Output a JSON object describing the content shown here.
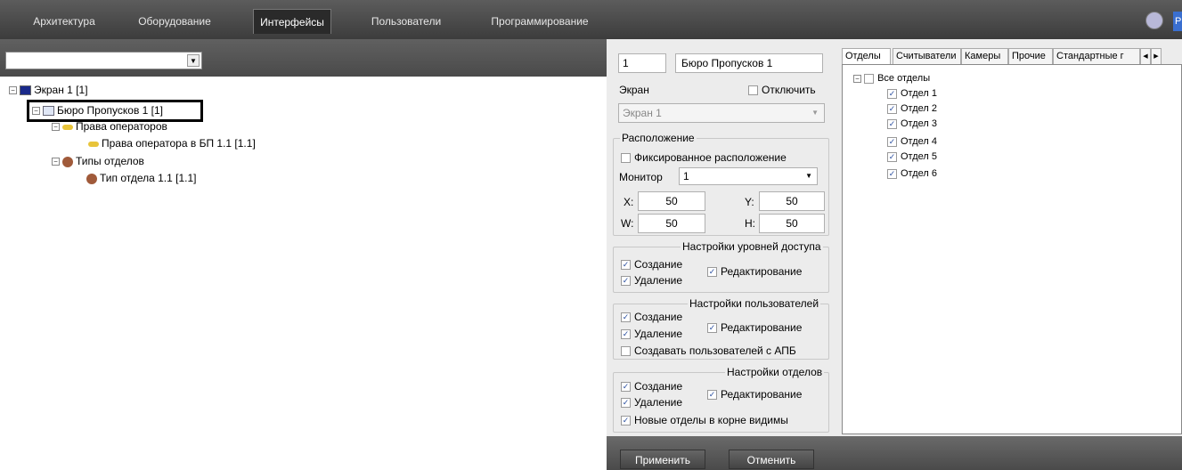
{
  "top_tabs": [
    "Архитектура",
    "Оборудование",
    "Интерфейсы",
    "Пользователи",
    "Программирование"
  ],
  "active_tab": "Интерфейсы",
  "top_right_label": "P",
  "tree": {
    "screen": "Экран 1 [1]",
    "bureau": "Бюро Пропусков 1 [1]",
    "operator_rights": "Права операторов",
    "operator_right_item": "Права оператора в БП 1.1 [1.1]",
    "dept_types": "Типы отделов",
    "dept_type_item": "Тип отдела 1.1 [1.1]"
  },
  "panel": {
    "id_value": "1",
    "name_value": "Бюро Пропусков 1",
    "screen_label": "Экран",
    "disable_label": "Отключить",
    "screen_value": "Экран 1",
    "location_title": "Расположение",
    "fixed_location": "Фиксированное расположение",
    "monitor_label": "Монитор",
    "monitor_value": "1",
    "x_label": "X:",
    "x_value": "50",
    "y_label": "Y:",
    "y_value": "50",
    "w_label": "W:",
    "w_value": "50",
    "h_label": "H:",
    "h_value": "50",
    "access_title": "Настройки уровней доступа",
    "users_title": "Настройки пользователей",
    "depts_title": "Настройки отделов",
    "create": "Создание",
    "delete": "Удаление",
    "edit": "Редактирование",
    "create_apb": "Создавать пользователей с АПБ",
    "new_depts_visible": "Новые отделы в корне видимы"
  },
  "right_tabs": [
    "Отделы",
    "Считыватели",
    "Камеры",
    "Прочие",
    "Стандартные г"
  ],
  "depts": {
    "all": "Все отделы",
    "items": [
      "Отдел 1",
      "Отдел 2",
      "Отдел 3",
      "Отдел 4",
      "Отдел 5",
      "Отдел 6"
    ]
  },
  "buttons": {
    "apply": "Применить",
    "cancel": "Отменить"
  }
}
